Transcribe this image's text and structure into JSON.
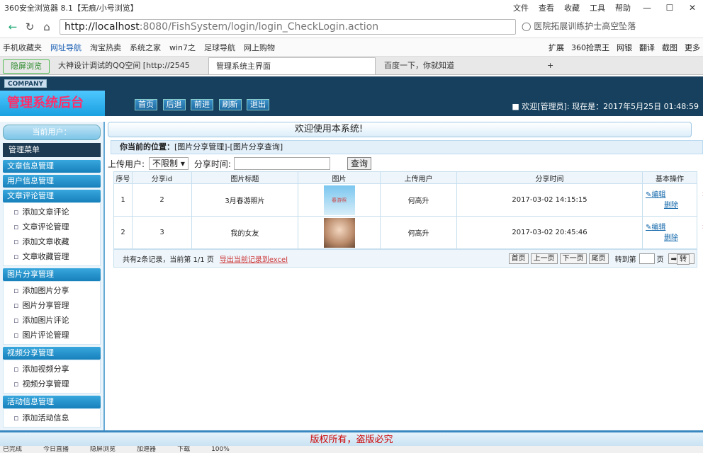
{
  "browser": {
    "title": "360安全浏览器 8.1【无痕/小号浏览】",
    "title_menu": [
      "文件",
      "查看",
      "收藏",
      "工具",
      "帮助"
    ],
    "url_host": "http://localhost",
    "url_rest": ":8080/FishSystem/login/login_CheckLogin.action",
    "search_text": "医院拓展训练护士高空坠落",
    "bookmarks": [
      "手机收藏夹",
      "网址导航",
      "淘宝热卖",
      "系统之家",
      "win7之",
      "足球导航",
      "网上购物"
    ],
    "bookmarks_right": [
      "扩展",
      "360抢票王",
      "网银",
      "翻译",
      "截图",
      "更多"
    ],
    "tabs": [
      "隐屏浏览",
      "大神设计调试的QQ空间 [http://2545",
      "管理系统主界面",
      "百度一下，你就知道"
    ],
    "active_tab": 2
  },
  "app": {
    "company": "COMPANY",
    "system_name": "管理系统后台",
    "nav": [
      "首页",
      "后退",
      "前进",
      "刷新",
      "退出"
    ],
    "welcome_user": "■ 欢迎[管理员]:   现在是：2017年5月25日 01:48:59"
  },
  "sidebar": {
    "current_user": "当前用户：",
    "menu_title": "管理菜单",
    "groups": [
      {
        "label": "文章信息管理",
        "items": []
      },
      {
        "label": "用户信息管理",
        "items": []
      },
      {
        "label": "文章评论管理",
        "items": [
          "添加文章评论",
          "文章评论管理",
          "添加文章收藏",
          "文章收藏管理"
        ]
      },
      {
        "label": "图片分享管理",
        "items": [
          "添加图片分享",
          "图片分享管理",
          "添加图片评论",
          "图片评论管理"
        ]
      },
      {
        "label": "视频分享管理",
        "items": [
          "添加视频分享",
          "视频分享管理"
        ]
      },
      {
        "label": "活动信息管理",
        "items": [
          "添加活动信息"
        ]
      }
    ]
  },
  "main": {
    "welcome": "欢迎使用本系统!",
    "position_label": "你当前的位置：",
    "position_value": "[图片分享管理]-[图片分享查询]",
    "filter": {
      "user_label": "上传用户:",
      "user_select": "不限制",
      "time_label": "分享时间:",
      "query_button": "查询"
    },
    "table": {
      "headers": [
        "序号",
        "分享id",
        "图片标题",
        "图片",
        "上传用户",
        "分享时间",
        "基本操作"
      ],
      "rows": [
        {
          "no": "1",
          "id": "2",
          "title": "3月春游照片",
          "thumb_text": "春游照",
          "user": "何高升",
          "time": "2017-03-02 14:15:15"
        },
        {
          "no": "2",
          "id": "3",
          "title": "我的女友",
          "thumb_text": "",
          "user": "何高升",
          "time": "2017-03-02 20:45:46"
        }
      ],
      "edit_label": "编辑",
      "delete_label": "删除"
    },
    "pager": {
      "summary": "共有2条记录，当前第 1/1 页",
      "export": "导出当前记录到excel",
      "buttons": [
        "首页",
        "上一页",
        "下一页",
        "尾页"
      ],
      "goto_label": "转到第",
      "page_unit": "页",
      "go": "转"
    }
  },
  "footer": {
    "copyright": "版权所有，盗版必究"
  },
  "statusbar": {
    "items": [
      "已完成",
      "今日直播",
      "隐屏浏览",
      "加速器",
      "下载",
      "100%"
    ]
  }
}
